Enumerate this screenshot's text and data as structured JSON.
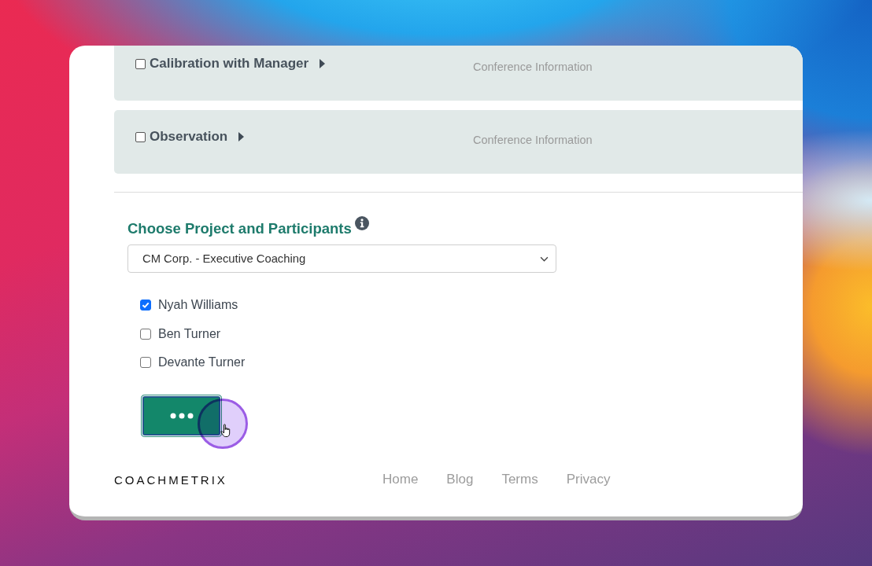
{
  "sessions": [
    {
      "title": "Calibration with Manager",
      "checked": false,
      "expanded": false,
      "info": "Conference Information"
    },
    {
      "title": "Observation",
      "checked": false,
      "expanded": false,
      "info": "Conference Information"
    }
  ],
  "project_section": {
    "heading": "Choose Project and Participants",
    "project_select": {
      "value": "CM Corp. - Executive Coaching"
    },
    "participants": [
      {
        "name": "Nyah Williams",
        "checked": true
      },
      {
        "name": "Ben Turner",
        "checked": false
      },
      {
        "name": "Devante Turner",
        "checked": false
      }
    ],
    "submit_button": {
      "loading": true
    }
  },
  "footer": {
    "logo": "COACHMETRIX",
    "links": [
      "Home",
      "Blog",
      "Terms",
      "Privacy"
    ]
  }
}
